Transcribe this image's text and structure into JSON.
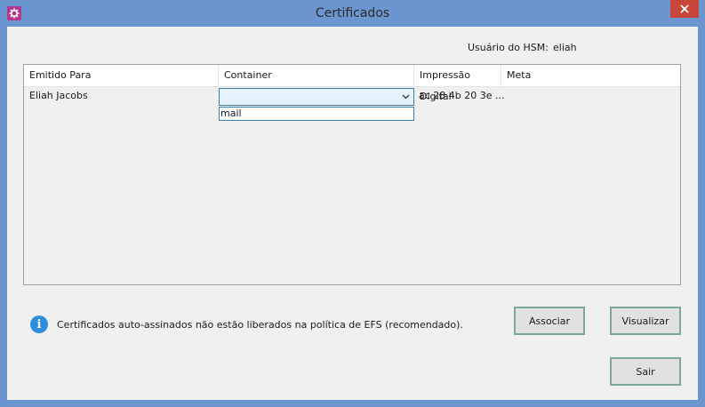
{
  "window": {
    "title": "Certificados"
  },
  "hsm": {
    "label": "Usuário do HSM:",
    "value": "eliah"
  },
  "grid": {
    "columns": [
      "Emitido Para",
      "Container",
      "Impressão Digital",
      "Meta"
    ],
    "rows": [
      {
        "emitido_para": "Eliah Jacobs",
        "container": "",
        "impressao_digital": "ac 28 4b 20 3e ...",
        "meta": ""
      }
    ],
    "dropdown_options": [
      "mail"
    ]
  },
  "info": {
    "message": "Certificados auto-assinados não estão liberados na política de EFS (recomendado)."
  },
  "buttons": {
    "associar": "Associar",
    "visualizar": "Visualizar",
    "sair": "Sair"
  },
  "icons": {
    "app": "gear-icon",
    "close": "close-icon",
    "info": "info-icon",
    "dropdown": "chevron-down-icon"
  },
  "colors": {
    "title_bar": "#6a95cf",
    "close_button": "#c7463a",
    "app_icon": "#b0398f",
    "info_icon": "#2e8ede",
    "combo_highlight": "#e5f1fb"
  }
}
